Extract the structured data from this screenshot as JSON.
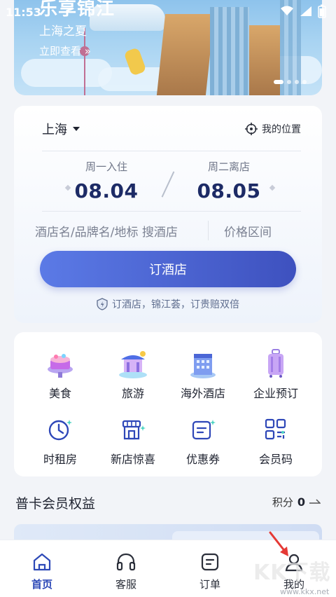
{
  "status": {
    "time": "11:53"
  },
  "banner": {
    "title": "乐享锦江",
    "subtitle": "上海之夏",
    "link": "立即查看 »"
  },
  "booking": {
    "city": "上海",
    "my_location": "我的位置",
    "checkin": {
      "label": "周一入住",
      "date": "08.04"
    },
    "checkout": {
      "label": "周二离店",
      "date": "08.05"
    },
    "search_placeholder": "酒店名/品牌名/地标 搜酒店",
    "price_range": "价格区间",
    "book_button": "订酒店",
    "promise": "订酒店，锦江荟，订贵赔双倍"
  },
  "services": [
    {
      "label": "美食",
      "icon": "food-cake-icon"
    },
    {
      "label": "旅游",
      "icon": "travel-pavilion-icon"
    },
    {
      "label": "海外酒店",
      "icon": "overseas-hotel-icon"
    },
    {
      "label": "企业预订",
      "icon": "luggage-icon"
    },
    {
      "label": "时租房",
      "icon": "clock-icon"
    },
    {
      "label": "新店惊喜",
      "icon": "new-store-icon"
    },
    {
      "label": "优惠券",
      "icon": "coupon-icon"
    },
    {
      "label": "会员码",
      "icon": "qr-code-icon"
    }
  ],
  "member": {
    "title": "普卡会员权益",
    "points_label": "积分",
    "points_value": "0"
  },
  "nav": [
    {
      "label": "首页",
      "icon": "home-icon",
      "active": true
    },
    {
      "label": "客服",
      "icon": "headset-icon",
      "active": false
    },
    {
      "label": "订单",
      "icon": "order-icon",
      "active": false
    },
    {
      "label": "我的",
      "icon": "profile-icon",
      "active": false
    }
  ],
  "watermark": {
    "text": "KK下载",
    "url": "www.kkx.net"
  },
  "colors": {
    "accent": "#3e51bf",
    "date": "#1d2b66",
    "nav_active": "#2d49b7"
  }
}
